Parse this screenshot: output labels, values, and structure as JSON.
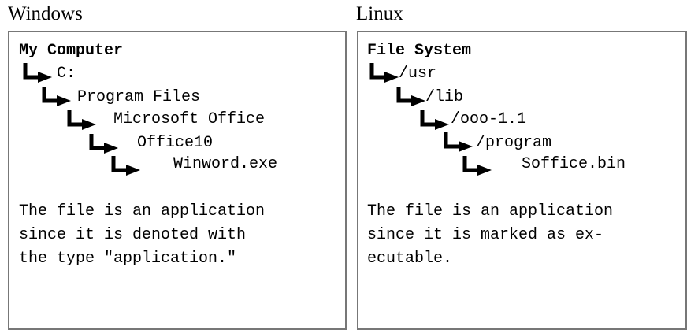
{
  "windows": {
    "title": "Windows",
    "root": "My Computer",
    "path": [
      "C:",
      "Program Files",
      "Microsoft Office",
      "Office10",
      "Winword.exe"
    ],
    "description": [
      "The file is an application",
      "since it is denoted with",
      "the type \"application.\""
    ]
  },
  "linux": {
    "title": "Linux",
    "root": "File System",
    "path": [
      "/usr",
      "/lib",
      "/ooo-1.1",
      "/program",
      "Soffice.bin"
    ],
    "description": [
      "The file is an application",
      "since it is marked as ex-",
      "ecutable."
    ]
  },
  "colors": {
    "border": "#777777",
    "text": "#000000",
    "background": "#ffffff"
  },
  "icons": {
    "tree_connector": "elbow-arrow-icon"
  }
}
